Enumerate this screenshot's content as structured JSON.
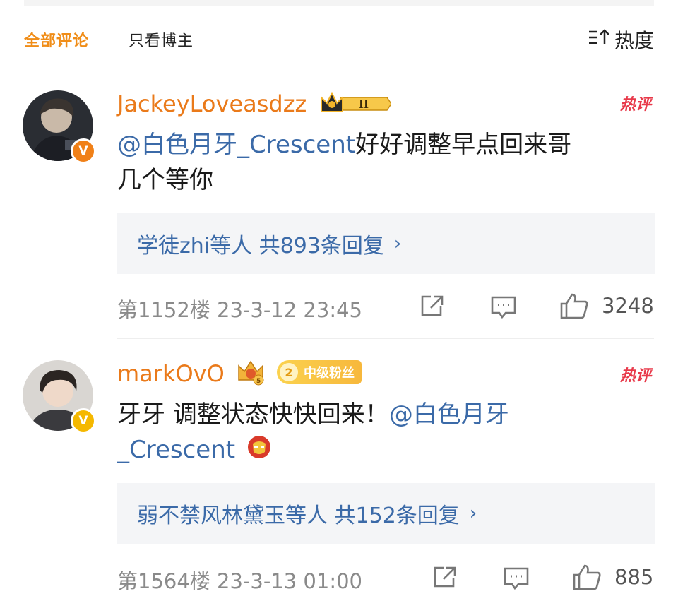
{
  "tabs": {
    "all_label": "全部评论",
    "author_only_label": "只看博主",
    "sort_label": "热度"
  },
  "comments": [
    {
      "username": "JackeyLoveasdzz",
      "badge_level": "II",
      "hot_label": "热评",
      "mention": "@白色月牙_Crescent",
      "text_line1": "好好调整早点回来哥",
      "text_line2": "几个等你",
      "replies": "学徒zhi等人  共893条回复",
      "floor": "第1152楼  23-3-12 23:45",
      "likes": "3248"
    },
    {
      "username": "markOvO",
      "fan_level": "2",
      "fan_label": "中级粉丝",
      "hot_label": "热评",
      "text": "牙牙 调整状态快快回来！",
      "mention_a": "@白色月牙",
      "mention_b": "_Crescent",
      "replies": "弱不禁风林黛玉等人  共152条回复",
      "floor": "第1564楼  23-3-13 01:00",
      "likes": "885"
    }
  ],
  "icons": [
    "sort-icon",
    "crown-badge-icon",
    "verified-v-icon",
    "share-icon",
    "comment-icon",
    "like-icon",
    "ironman-emoji-icon"
  ],
  "colors": {
    "accent": "#f08d18",
    "username": "#ea7a1a",
    "link": "#3b6aa8",
    "hot": "#e8394a",
    "muted": "#8a8a8a"
  }
}
